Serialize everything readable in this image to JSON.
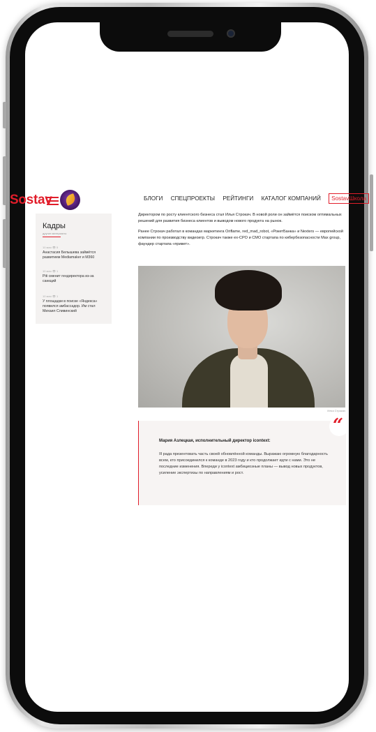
{
  "header": {
    "logo": "Sostav",
    "nav": [
      "БЛОГИ",
      "СПЕЦПРОЕКТЫ",
      "РЕЙТИНГИ",
      "КАТАЛОГ КОМПАНИЙ"
    ],
    "school_brand": "Sostav",
    "school_label": "Школа"
  },
  "sidebar": {
    "title": "Кадры",
    "subtitle": "другие материалы",
    "items": [
      {
        "meta": "10 мая  👁 5",
        "text": "Анастасия Белышева займётся развитием Mediamaker и M360"
      },
      {
        "meta": "10 мая  👁 1",
        "text": "Piti сменит гендиректора из-за санкций"
      },
      {
        "meta": "10 мая  👁 1",
        "text": "У площадки в поиске «Яндекса» появился амбассадор. Им стал Михаил Сливинский"
      }
    ]
  },
  "article": {
    "para1": "Директором по росту клиентского бизнеса стал Илья Строкач. В новой роли он займётся поиском оптимальных решений для развития бизнеса клиентов и выводом нового продукта на рынок.",
    "para2": "Ранее Строкач работал в командах маркетинга Oriflame, red_mad_robot, «РокетБанка» и Nexters — европейской компании по производству видеоигр. Строкач также ex-CPO и CMO стартапа по кибербезопасности Max group, фаундер стартапа «привет».",
    "photo_caption": "Илья Строкач"
  },
  "quote": {
    "mark": "“",
    "author": "Мария Азлецкая, исполнительный директор icontext:",
    "text": "Я рада презентовать часть своей обновлённой команды. Выражаю огромную благодарность всем, кто присоединился к команде в 2023 году и кто продолжает идти с нами. Это не последние изменения. Впереди у icontext амбициозные планы — вывод новых продуктов, усиление экспертизы по направлениям и рост."
  },
  "colors": {
    "accent": "#e11d2a",
    "frame": "#0c0c0c"
  },
  "icons": [
    "burger-icon",
    "feather-logo-icon",
    "views-icon",
    "quote-mark-icon"
  ]
}
